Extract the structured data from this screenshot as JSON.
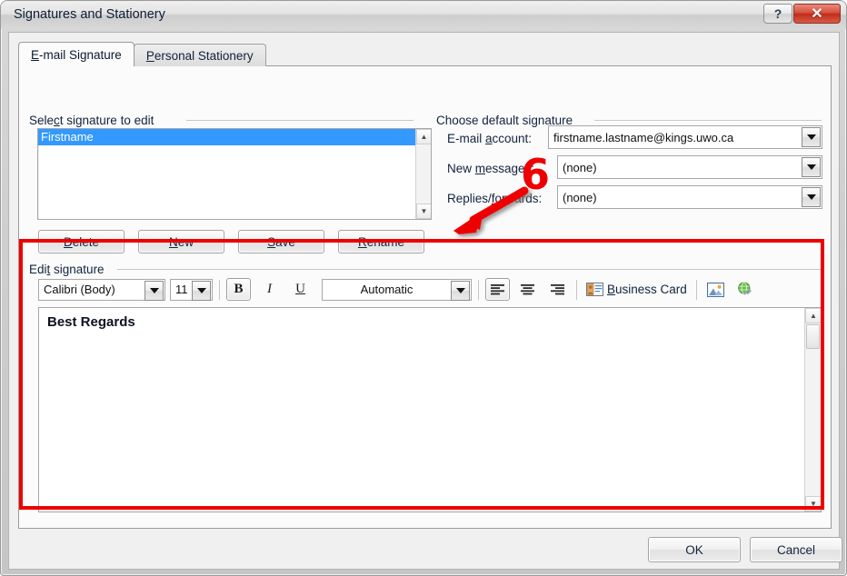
{
  "window": {
    "title": "Signatures and Stationery",
    "help_label": "?",
    "close_label": "✕"
  },
  "tabs": [
    {
      "label": "E-mail Signature",
      "accel": "E",
      "active": true
    },
    {
      "label": "Personal Stationery",
      "accel": "P",
      "active": false
    }
  ],
  "select_signature": {
    "group_label": "Select signature to edit",
    "group_accel": "c",
    "items": [
      "Firstname"
    ],
    "selected_index": 0,
    "buttons": [
      {
        "label": "Delete",
        "accel": "D"
      },
      {
        "label": "New",
        "accel": "N"
      },
      {
        "label": "Save",
        "accel": "S"
      },
      {
        "label": "Rename",
        "accel": "R"
      }
    ]
  },
  "default_signature": {
    "group_label": "Choose default signature",
    "rows": [
      {
        "label": "E-mail account:",
        "accel": "a",
        "value": "firstname.lastname@kings.uwo.ca"
      },
      {
        "label": "New messages:",
        "accel": "m",
        "value": "(none)"
      },
      {
        "label": "Replies/forwards:",
        "accel": "f",
        "value": "(none)"
      }
    ]
  },
  "edit_signature": {
    "group_label": "Edit signature",
    "group_accel": "t",
    "toolbar": {
      "font_name": "Calibri (Body)",
      "font_size": "11",
      "bold_label": "B",
      "bold_active": true,
      "italic_label": "I",
      "underline_label": "U",
      "font_color": "Automatic",
      "align_left_active": true,
      "business_card_label": "Business Card",
      "business_card_accel": "B",
      "icons": {
        "bold": "bold-icon",
        "italic": "italic-icon",
        "underline": "underline-icon",
        "align_left": "align-left-icon",
        "align_center": "align-center-icon",
        "align_right": "align-right-icon",
        "business_card": "business-card-icon",
        "picture": "insert-picture-icon",
        "hyperlink": "insert-hyperlink-icon"
      }
    },
    "content": "Best Regards"
  },
  "footer": {
    "ok_label": "OK",
    "cancel_label": "Cancel"
  },
  "annotations": {
    "step_number": "6",
    "highlight_color": "#ee0000"
  }
}
